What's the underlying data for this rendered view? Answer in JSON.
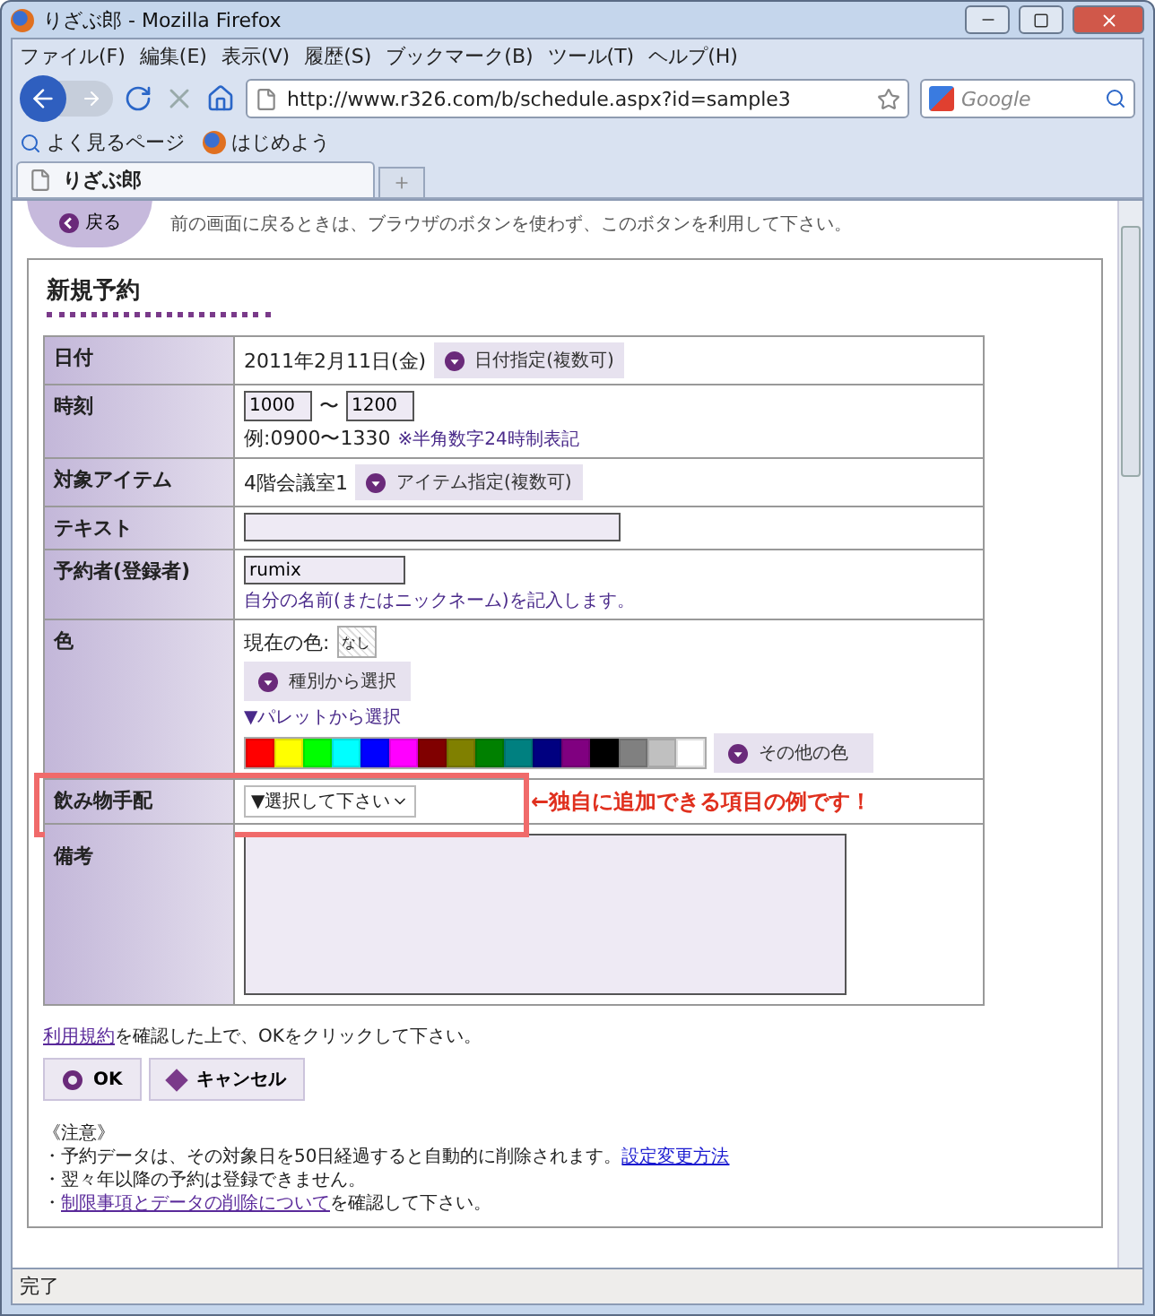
{
  "window": {
    "title": "りざぶ郎 - Mozilla Firefox"
  },
  "menu": [
    "ファイル(F)",
    "編集(E)",
    "表示(V)",
    "履歴(S)",
    "ブックマーク(B)",
    "ツール(T)",
    "ヘルプ(H)"
  ],
  "navigation": {
    "url": "http://www.r326.com/b/schedule.aspx?id=sample3",
    "search_placeholder": "Google"
  },
  "bookmarks": [
    "よく見るページ",
    "はじめよう"
  ],
  "tabs": [
    {
      "label": "りざぶ郎",
      "selected": true
    }
  ],
  "back": {
    "label": "戻る",
    "hint": "前の画面に戻るときは、ブラウザのボタンを使わず、このボタンを利用して下さい。"
  },
  "form": {
    "title": "新規予約",
    "rows": [
      {
        "kind": "date",
        "label": "日付",
        "value": "2011年2月11日(金)",
        "button": "日付指定(複数可)"
      },
      {
        "kind": "time",
        "label": "時刻",
        "start": "1000",
        "separator": "〜",
        "end": "1200",
        "example": "例:0900〜1330",
        "note": "※半角数字24時制表記"
      },
      {
        "kind": "item",
        "label": "対象アイテム",
        "value": "4階会議室1",
        "button": "アイテム指定(複数可)"
      },
      {
        "kind": "text",
        "label": "テキスト"
      },
      {
        "kind": "person",
        "label": "予約者(登録者)",
        "value": "rumix",
        "hint": "自分の名前(またはニックネーム)を記入します。"
      },
      {
        "kind": "color",
        "label": "色",
        "current_label": "現在の色:",
        "current_value": "なし",
        "category_button": "種別から選択",
        "palette_label": "▼パレットから選択",
        "other_button": "その他の色",
        "swatches": [
          {
            "color": "#ff0000"
          },
          {
            "color": "#ffff00"
          },
          {
            "color": "#00ff00"
          },
          {
            "color": "#00ffff"
          },
          {
            "color": "#0000ff"
          },
          {
            "color": "#ff00ff"
          },
          {
            "color": "#800000"
          },
          {
            "color": "#808000"
          },
          {
            "color": "#008000"
          },
          {
            "color": "#008080"
          },
          {
            "color": "#000080"
          },
          {
            "color": "#800080"
          },
          {
            "color": "#000000"
          },
          {
            "color": "#808080"
          },
          {
            "color": "#c0c0c0"
          },
          {
            "color": "#ffffff"
          }
        ]
      },
      {
        "kind": "drink",
        "label": "飲み物手配",
        "select": "▼選択して下さい",
        "highlighted": true,
        "annotation": "←独自に追加できる項目の例です！"
      },
      {
        "kind": "memo",
        "label": "備考"
      }
    ]
  },
  "terms": {
    "link": "利用規約",
    "text": "を確認した上で、OKをクリックして下さい。"
  },
  "buttons": [
    {
      "kind": "ok",
      "label": "OK"
    },
    {
      "kind": "cancel",
      "label": "キャンセル"
    }
  ],
  "notes": {
    "title": "《注意》",
    "lines": [
      {
        "text": "・予約データは、その対象日を50日経過すると自動的に削除されます。",
        "link": "設定変更方法"
      },
      {
        "text": "・翌々年以降の予約は登録できません。"
      },
      {
        "text": "・",
        "link": "制限事項とデータの削除について",
        "after": "を確認して下さい。"
      }
    ]
  },
  "status_bar": "完了"
}
